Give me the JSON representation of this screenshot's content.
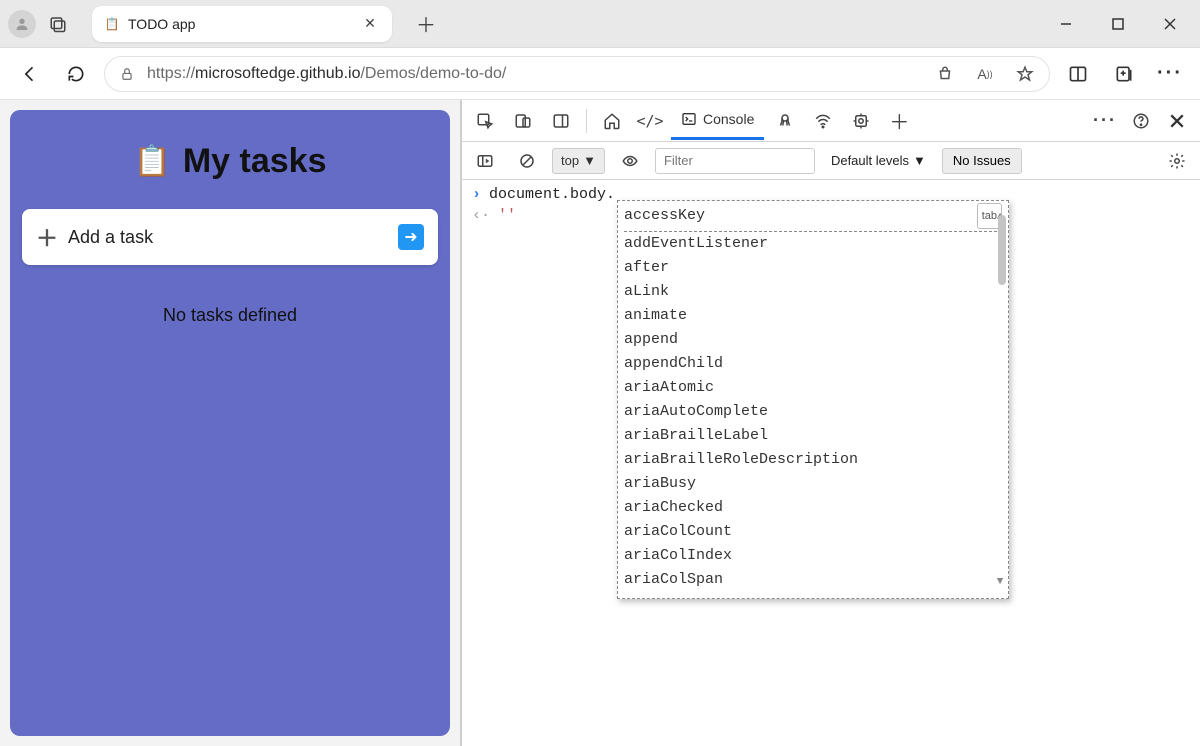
{
  "browser": {
    "tab_title": "TODO app",
    "url_prefix": "https://",
    "url_host": "microsoftedge.github.io",
    "url_path": "/Demos/demo-to-do/"
  },
  "page": {
    "title": "My tasks",
    "add_label": "Add a task",
    "empty_label": "No tasks defined"
  },
  "devtools": {
    "tab_console": "Console",
    "context": "top",
    "filter_placeholder": "Filter",
    "levels_label": "Default levels",
    "issues_label": "No Issues",
    "input_text": "document.body.",
    "output_text": "''",
    "tab_hint": "tab",
    "suggestions": [
      "accessKey",
      "addEventListener",
      "after",
      "aLink",
      "animate",
      "append",
      "appendChild",
      "ariaAtomic",
      "ariaAutoComplete",
      "ariaBrailleLabel",
      "ariaBrailleRoleDescription",
      "ariaBusy",
      "ariaChecked",
      "ariaColCount",
      "ariaColIndex",
      "ariaColSpan"
    ]
  }
}
